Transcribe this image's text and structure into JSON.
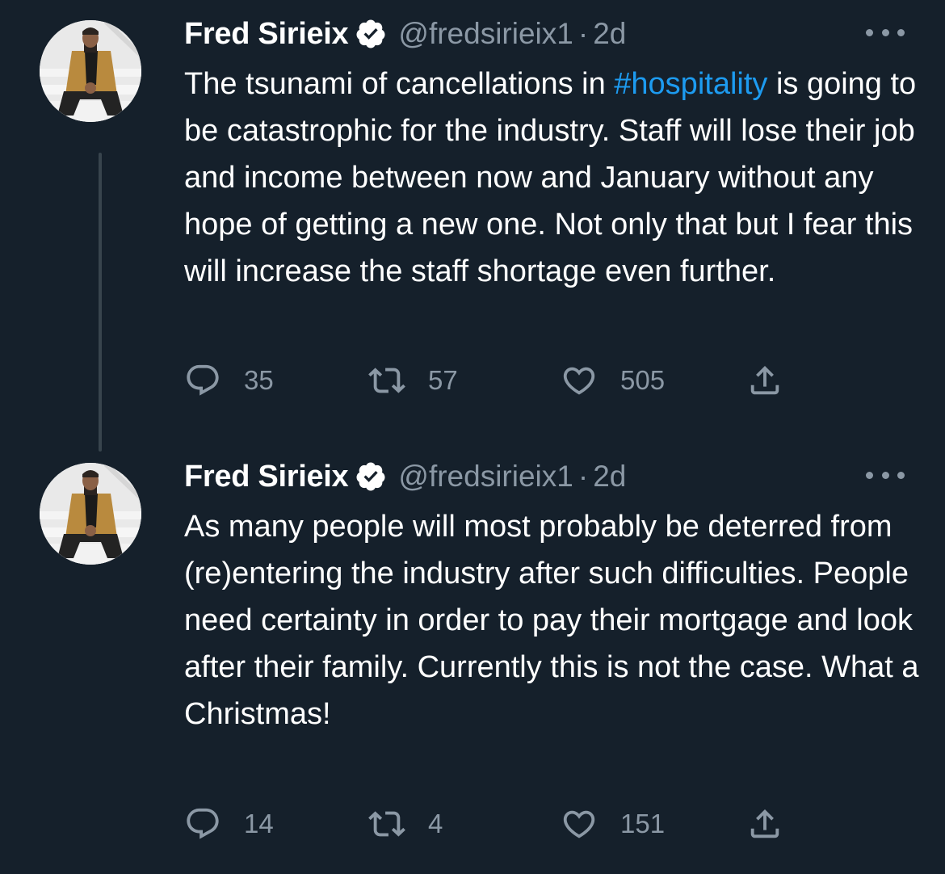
{
  "tweets": [
    {
      "author": {
        "name": "Fred Sirieix",
        "handle": "@fredsirieix1",
        "verified": true
      },
      "separator": "·",
      "timestamp": "2d",
      "text_before_hashtag": "The tsunami of cancellations in ",
      "hashtag": "#hospitality",
      "text_after_hashtag": " is going to be catastrophic for the industry. Staff will lose their job and income between now and January without any hope of getting a new one. Not only that but I fear this will increase the staff shortage even further.",
      "stats": {
        "replies": "35",
        "retweets": "57",
        "likes": "505"
      }
    },
    {
      "author": {
        "name": "Fred Sirieix",
        "handle": "@fredsirieix1",
        "verified": true
      },
      "separator": "·",
      "timestamp": "2d",
      "text": "As many people will most probably be deterred from (re)entering the industry after such difficulties. People need certainty in order to pay their mortgage and look after their family. Currently this is not the case. What a Christmas!",
      "stats": {
        "replies": "14",
        "retweets": "4",
        "likes": "151"
      }
    }
  ],
  "icons": {
    "verified": "verified-badge-icon",
    "more": "more-options-icon",
    "reply": "reply-icon",
    "retweet": "retweet-icon",
    "like": "like-heart-icon",
    "share": "share-icon"
  },
  "colors": {
    "background": "#15202b",
    "text": "#ffffff",
    "secondary_text": "#8b98a5",
    "hashtag": "#1d9bf0",
    "thread_line": "#38444d"
  }
}
